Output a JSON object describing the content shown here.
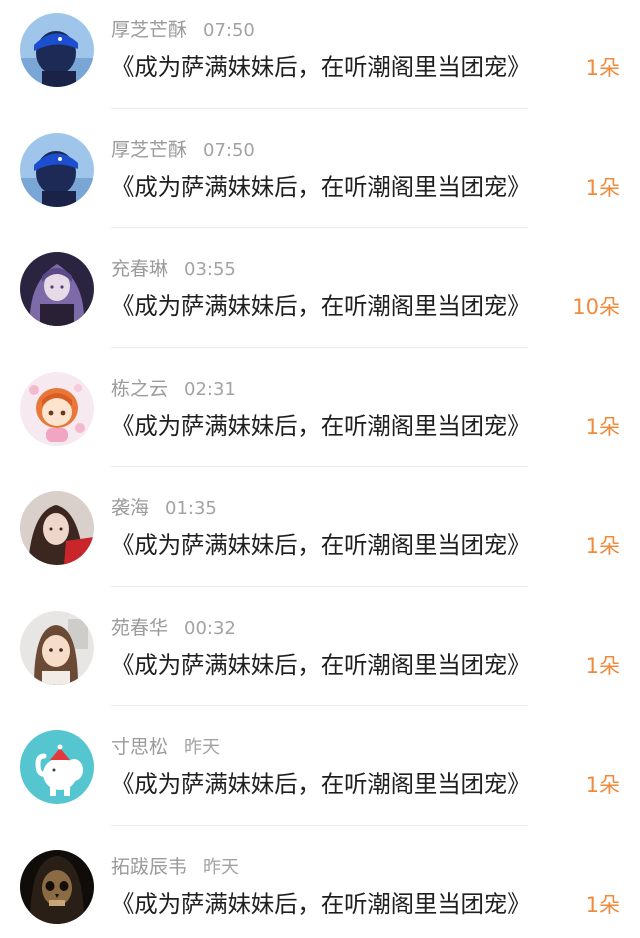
{
  "items": [
    {
      "name": "厚芝芒酥",
      "time": "07:50",
      "book": "《成为萨满妹妹后，在听潮阁里当团宠》",
      "gift": "1朵",
      "avatar": "blue-cap-avatar"
    },
    {
      "name": "厚芝芒酥",
      "time": "07:50",
      "book": "《成为萨满妹妹后，在听潮阁里当团宠》",
      "gift": "1朵",
      "avatar": "blue-cap-avatar"
    },
    {
      "name": "充春琳",
      "time": "03:55",
      "book": "《成为萨满妹妹后，在听潮阁里当团宠》",
      "gift": "10朵",
      "avatar": "anime-purple-hair-avatar"
    },
    {
      "name": "栋之云",
      "time": "02:31",
      "book": "《成为萨满妹妹后，在听潮阁里当团宠》",
      "gift": "1朵",
      "avatar": "cartoon-girl-avatar"
    },
    {
      "name": "袭海",
      "time": "01:35",
      "book": "《成为萨满妹妹后，在听潮阁里当团宠》",
      "gift": "1朵",
      "avatar": "woman-red-coat-avatar"
    },
    {
      "name": "苑春华",
      "time": "00:32",
      "book": "《成为萨满妹妹后，在听潮阁里当团宠》",
      "gift": "1朵",
      "avatar": "little-girl-photo-avatar"
    },
    {
      "name": "寸思松",
      "time": "昨天",
      "book": "《成为萨满妹妹后，在听潮阁里当团宠》",
      "gift": "1朵",
      "avatar": "elephant-cartoon-avatar"
    },
    {
      "name": "拓跋辰韦",
      "time": "昨天",
      "book": "《成为萨满妹妹后，在听潮阁里当团宠》",
      "gift": "1朵",
      "avatar": "dark-skull-avatar"
    }
  ]
}
